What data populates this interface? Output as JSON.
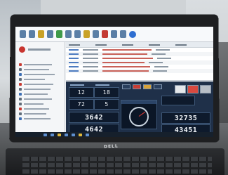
{
  "dashboard": {
    "readouts": [
      {
        "name": "readout-tl-1",
        "value": "12"
      },
      {
        "name": "readout-tl-2",
        "value": "18"
      },
      {
        "name": "readout-ml-1",
        "value": "72"
      },
      {
        "name": "readout-ml-2",
        "value": "5"
      },
      {
        "name": "readout-bl-1",
        "value": "3642"
      },
      {
        "name": "readout-bl-2",
        "value": "4642"
      },
      {
        "name": "readout-r-1",
        "value": "32735"
      },
      {
        "name": "readout-r-2",
        "value": "43451"
      }
    ]
  },
  "laptop": {
    "brand": "DELL"
  }
}
